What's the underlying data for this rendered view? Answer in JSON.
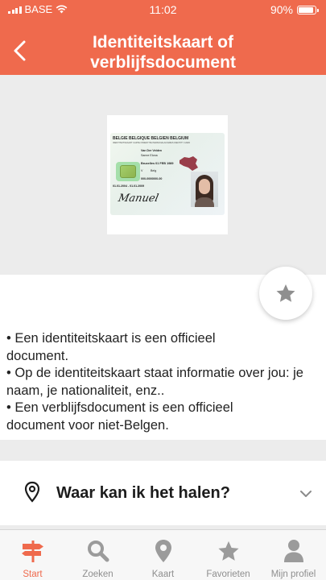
{
  "status_bar": {
    "carrier": "BASE",
    "time": "11:02",
    "battery": "90%"
  },
  "header": {
    "title": "Identiteitskaart of verblijfsdocument",
    "back_icon": "chevron-left-icon"
  },
  "id_card": {
    "header_line": "BELGIË    BELGIQUE    BELGIEN    BELGIUM",
    "subheader": "IDENTITEITSKAART   CARTE D'IDENTITÉ   PERSONALAUSWEIS   IDENTITY CARD",
    "name": "Van Der Velden",
    "given_name": "Sanne Elona",
    "birth": "Bruxelles  01 FEB 1989",
    "sex": "V",
    "nationality": "Belg",
    "card_number": "000-0000000-00",
    "valid": "01.01.2004 - 01.01.2009",
    "signature": "Manuel"
  },
  "info": {
    "bullets": [
      "• Een identiteitskaart is een officieel document.",
      "• Op de identiteitskaart staat informatie over jou: je naam, je nationaliteit, enz..",
      "• Een verblijfsdocument is een officieel document voor niet-Belgen."
    ]
  },
  "where": {
    "label": "Waar kan ik het halen?"
  },
  "tabs": [
    {
      "label": "Start",
      "icon": "signpost-icon",
      "active": true
    },
    {
      "label": "Zoeken",
      "icon": "search-icon",
      "active": false
    },
    {
      "label": "Kaart",
      "icon": "map-pin-icon",
      "active": false
    },
    {
      "label": "Favorieten",
      "icon": "star-icon",
      "active": false
    },
    {
      "label": "Mijn profiel",
      "icon": "person-icon",
      "active": false
    }
  ],
  "colors": {
    "accent": "#ef6a4d",
    "inactive": "#8e8e8e",
    "icon_grey": "#9b9b9b"
  }
}
